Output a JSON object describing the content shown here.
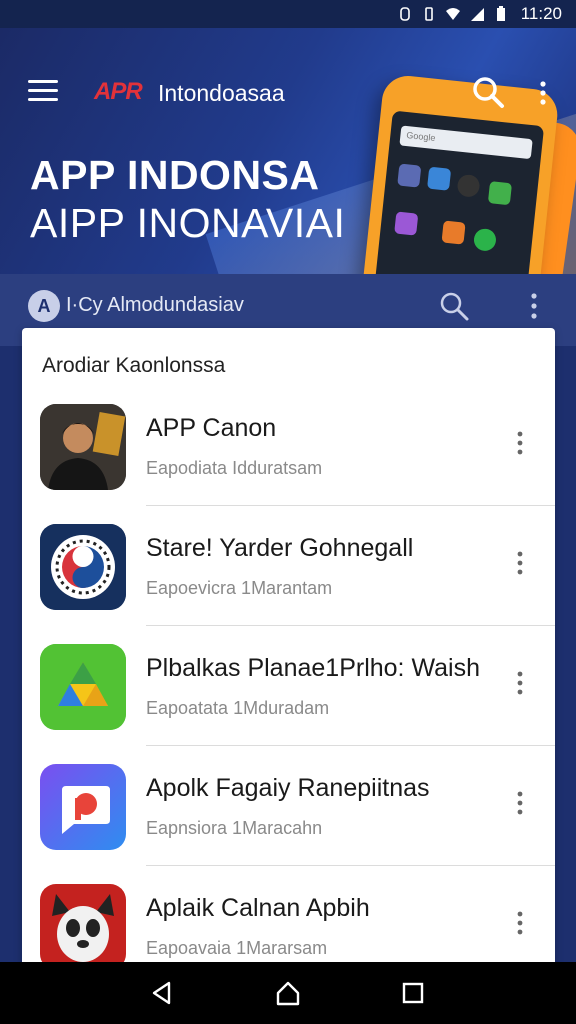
{
  "status_bar": {
    "time": "11:20",
    "icons": [
      "nfc-icon",
      "vibrate-icon",
      "wifi-icon",
      "signal-icon",
      "battery-icon"
    ]
  },
  "header": {
    "logo": "APR",
    "brand": "Intondoasaa",
    "headline_line1": "APP INDONSA",
    "headline_line2": "AIPP INONAVIAI",
    "phone_search_placeholder": "Google"
  },
  "subbar": {
    "avatar_letter": "A",
    "title": "I·Cy Almodundasiav"
  },
  "card": {
    "section_title": "Arodiar Kaonlonssa",
    "apps": [
      {
        "name": "APP Canon",
        "subtitle": "Eapodiata  Idduratsam",
        "icon": "person-photo-icon"
      },
      {
        "name": "Stare! Yarder Gohnegall",
        "subtitle": "Eapoevicra  1Marantam",
        "icon": "circle-badge-icon"
      },
      {
        "name": "Plbalkas Planae1Prlho: Waish",
        "subtitle": "Eapoatata  1Mduradam",
        "icon": "triangle-drive-icon"
      },
      {
        "name": "Apolk Fagaiy Ranepiitnas",
        "subtitle": "Eapnsiora  1Maracahn",
        "icon": "chat-p-icon"
      },
      {
        "name": "Aplaik Calnan Apbih",
        "subtitle": "Eapoavaia  1Mararsam",
        "icon": "panda-icon"
      }
    ]
  },
  "colors": {
    "header_bg": "#1d2f6e",
    "accent_orange": "#f7a128",
    "logo_red": "#e2323a"
  },
  "navbar": {
    "buttons": [
      "back-icon",
      "home-icon",
      "recents-icon"
    ]
  }
}
